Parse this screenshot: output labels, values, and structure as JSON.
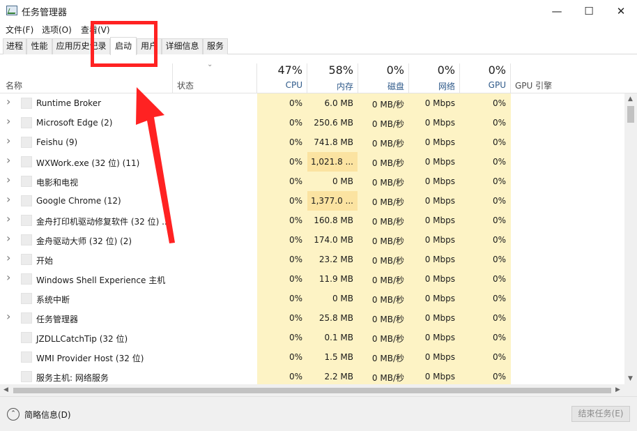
{
  "window": {
    "title": "任务管理器",
    "minimize": "—",
    "maximize": "☐",
    "close": "✕"
  },
  "menu": [
    "文件(F)",
    "选项(O)",
    "查看(V)"
  ],
  "tabs": [
    "进程",
    "性能",
    "应用历史记录",
    "启动",
    "用户",
    "详细信息",
    "服务"
  ],
  "active_tab": "启动",
  "header": {
    "name": "名称",
    "status": "状态",
    "sort_indicator": "⌄",
    "cpu": {
      "pct": "47%",
      "label": "CPU"
    },
    "memory": {
      "pct": "58%",
      "label": "内存"
    },
    "disk": {
      "pct": "0%",
      "label": "磁盘"
    },
    "network": {
      "pct": "0%",
      "label": "网络"
    },
    "gpu": {
      "pct": "0%",
      "label": "GPU"
    },
    "gpu_engine": "GPU 引擎"
  },
  "rows": [
    {
      "name": "Runtime Broker",
      "expandable": true,
      "cpu": "0%",
      "mem": "6.0 MB",
      "disk": "0 MB/秒",
      "net": "0 Mbps",
      "gpu": "0%"
    },
    {
      "name": "Microsoft Edge (2)",
      "expandable": true,
      "cpu": "0%",
      "mem": "250.6 MB",
      "disk": "0 MB/秒",
      "net": "0 Mbps",
      "gpu": "0%"
    },
    {
      "name": "Feishu (9)",
      "expandable": true,
      "cpu": "0%",
      "mem": "741.8 MB",
      "disk": "0 MB/秒",
      "net": "0 Mbps",
      "gpu": "0%"
    },
    {
      "name": "WXWork.exe (32 位) (11)",
      "expandable": true,
      "cpu": "0%",
      "mem": "1,021.8 ...",
      "disk": "0 MB/秒",
      "net": "0 Mbps",
      "gpu": "0%",
      "memhl": true
    },
    {
      "name": "电影和电视",
      "expandable": true,
      "cpu": "0%",
      "mem": "0 MB",
      "disk": "0 MB/秒",
      "net": "0 Mbps",
      "gpu": "0%"
    },
    {
      "name": "Google Chrome (12)",
      "expandable": true,
      "cpu": "0%",
      "mem": "1,377.0 ...",
      "disk": "0 MB/秒",
      "net": "0 Mbps",
      "gpu": "0%",
      "memhl": true
    },
    {
      "name": "金舟打印机驱动修复软件 (32 位) ...",
      "expandable": true,
      "cpu": "0%",
      "mem": "160.8 MB",
      "disk": "0 MB/秒",
      "net": "0 Mbps",
      "gpu": "0%"
    },
    {
      "name": "金舟驱动大师 (32 位) (2)",
      "expandable": true,
      "cpu": "0%",
      "mem": "174.0 MB",
      "disk": "0 MB/秒",
      "net": "0 Mbps",
      "gpu": "0%"
    },
    {
      "name": "开始",
      "expandable": true,
      "cpu": "0%",
      "mem": "23.2 MB",
      "disk": "0 MB/秒",
      "net": "0 Mbps",
      "gpu": "0%"
    },
    {
      "name": "Windows Shell Experience 主机",
      "expandable": true,
      "cpu": "0%",
      "mem": "11.9 MB",
      "disk": "0 MB/秒",
      "net": "0 Mbps",
      "gpu": "0%"
    },
    {
      "name": "系统中断",
      "expandable": false,
      "cpu": "0%",
      "mem": "0 MB",
      "disk": "0 MB/秒",
      "net": "0 Mbps",
      "gpu": "0%"
    },
    {
      "name": "任务管理器",
      "expandable": true,
      "cpu": "0%",
      "mem": "25.8 MB",
      "disk": "0 MB/秒",
      "net": "0 Mbps",
      "gpu": "0%"
    },
    {
      "name": "JZDLLCatchTip (32 位)",
      "expandable": false,
      "cpu": "0%",
      "mem": "0.1 MB",
      "disk": "0 MB/秒",
      "net": "0 Mbps",
      "gpu": "0%"
    },
    {
      "name": "WMI Provider Host (32 位)",
      "expandable": false,
      "cpu": "0%",
      "mem": "1.5 MB",
      "disk": "0 MB/秒",
      "net": "0 Mbps",
      "gpu": "0%"
    },
    {
      "name": "服务主机: 网络服务",
      "expandable": false,
      "cpu": "0%",
      "mem": "2.2 MB",
      "disk": "0 MB/秒",
      "net": "0 Mbps",
      "gpu": "0%"
    }
  ],
  "footer": {
    "fewer_details": "简略信息(D)",
    "end_task": "结束任务(E)"
  },
  "colors": {
    "highlight_column": "#fdf3c5",
    "highlight_cell": "#fbe3a1",
    "annotation": "#ff2222"
  }
}
